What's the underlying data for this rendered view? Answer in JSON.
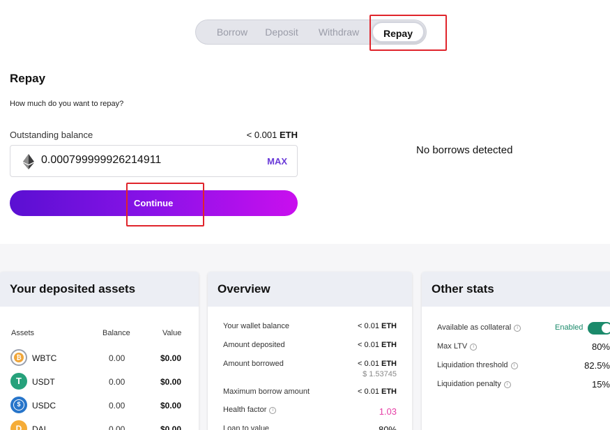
{
  "tabs": {
    "items": [
      "Borrow",
      "Deposit",
      "Withdraw",
      "Repay"
    ],
    "active": "Repay"
  },
  "repay": {
    "title": "Repay",
    "question": "How much do you want to repay?",
    "outstanding_label": "Outstanding balance",
    "outstanding_value": "< 0.001",
    "outstanding_unit": "ETH",
    "amount_value": "0.000799999926214911",
    "max_label": "MAX",
    "continue_label": "Continue",
    "eth_icon": "ethereum-icon"
  },
  "right_panel": {
    "message": "No borrows detected"
  },
  "deposited": {
    "title": "Your deposited assets",
    "headers": [
      "Assets",
      "Balance",
      "Value"
    ],
    "rows": [
      {
        "name": "WBTC",
        "balance": "0.00",
        "value": "$0.00",
        "icon": "wbtc-icon",
        "color": "#f0a63a"
      },
      {
        "name": "USDT",
        "balance": "0.00",
        "value": "$0.00",
        "icon": "usdt-icon",
        "color": "#26a17b"
      },
      {
        "name": "USDC",
        "balance": "0.00",
        "value": "$0.00",
        "icon": "usdc-icon",
        "color": "#2775ca"
      },
      {
        "name": "DAI",
        "balance": "0.00",
        "value": "$0.00",
        "icon": "dai-icon",
        "color": "#f5ac37"
      }
    ]
  },
  "overview": {
    "title": "Overview",
    "wallet_label": "Your wallet balance",
    "wallet_value": "< 0.01",
    "deposited_label": "Amount deposited",
    "deposited_value": "< 0.01",
    "borrowed_label": "Amount borrowed",
    "borrowed_value": "< 0.01",
    "borrowed_usd": "$ 1.53745",
    "max_borrow_label": "Maximum borrow amount",
    "max_borrow_value": "< 0.01",
    "health_label": "Health factor",
    "health_value": "1.03",
    "ltv_label": "Loan to value",
    "ltv_value": "80%",
    "unit": "ETH"
  },
  "other_stats": {
    "title": "Other stats",
    "collateral_label": "Available as collateral",
    "collateral_status": "Enabled",
    "max_ltv_label": "Max LTV",
    "max_ltv_value": "80%",
    "liq_threshold_label": "Liquidation threshold",
    "liq_threshold_value": "82.5%",
    "liq_penalty_label": "Liquidation penalty",
    "liq_penalty_value": "15%"
  }
}
